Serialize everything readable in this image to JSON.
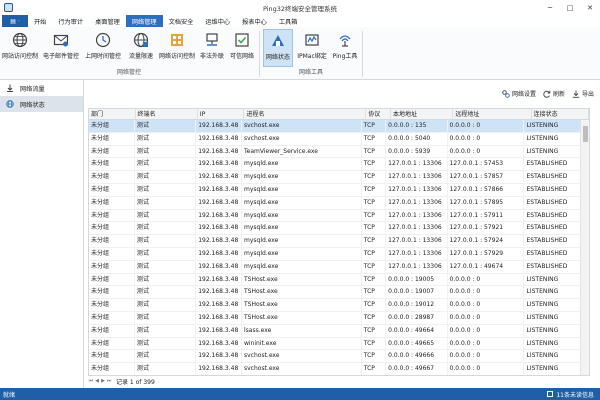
{
  "window": {
    "title": "Ping32终端安全管理系统",
    "minimize": "─",
    "maximize": "□",
    "close": "✕"
  },
  "menu": {
    "app_button": "▤ ·",
    "tabs": [
      "开始",
      "行为审计",
      "桌面管理",
      "网络管理",
      "文档安全",
      "运维中心",
      "报表中心",
      "工具箱"
    ],
    "active_tab": "网络管理"
  },
  "ribbon": {
    "group1": {
      "label": "网络管控",
      "buttons": [
        {
          "label": "网站访问控制",
          "icon": "globe-icon"
        },
        {
          "label": "电子邮件管控",
          "icon": "email-icon"
        },
        {
          "label": "上网时间管控",
          "icon": "clock-icon"
        },
        {
          "label": "流量限速",
          "icon": "speed-globe-icon"
        },
        {
          "label": "网络访问控制",
          "icon": "network-access-icon"
        },
        {
          "label": "非法外联",
          "icon": "external-connection-icon"
        },
        {
          "label": "可信网络",
          "icon": "trusted-network-icon"
        }
      ]
    },
    "group2": {
      "label": "网络工具",
      "buttons": [
        {
          "label": "网络状态",
          "icon": "network-status-icon"
        },
        {
          "label": "IPMac绑定",
          "icon": "ipmac-icon"
        },
        {
          "label": "Ping工具",
          "icon": "ping-icon"
        }
      ],
      "selected": "网络状态"
    }
  },
  "left_panel": {
    "items": [
      {
        "label": "网络流量",
        "icon": "download-arrow-icon"
      },
      {
        "label": "网络状态",
        "icon": "globe-icon"
      }
    ],
    "selected": "网络状态"
  },
  "toolbar": {
    "settings": "网络设置",
    "refresh": "刷新",
    "export": "导出"
  },
  "table": {
    "columns": [
      "部门",
      "终端名",
      "IP",
      "进程名",
      "协议",
      "本地地址",
      "远程地址",
      "连接状态"
    ],
    "rows": [
      [
        "未分组",
        "测试",
        "192.168.3.48",
        "svchost.exe",
        "TCP",
        "0.0.0.0 : 135",
        "0.0.0.0 : 0",
        "LISTENING"
      ],
      [
        "未分组",
        "测试",
        "192.168.3.48",
        "svchost.exe",
        "TCP",
        "0.0.0.0 : 5040",
        "0.0.0.0 : 0",
        "LISTENING"
      ],
      [
        "未分组",
        "测试",
        "192.168.3.48",
        "TeamViewer_Service.exe",
        "TCP",
        "0.0.0.0 : 5939",
        "0.0.0.0 : 0",
        "LISTENING"
      ],
      [
        "未分组",
        "测试",
        "192.168.3.48",
        "mysqld.exe",
        "TCP",
        "127.0.0.1 : 13306",
        "127.0.0.1 : 57453",
        "ESTABLISHED"
      ],
      [
        "未分组",
        "测试",
        "192.168.3.48",
        "mysqld.exe",
        "TCP",
        "127.0.0.1 : 13306",
        "127.0.0.1 : 57857",
        "ESTABLISHED"
      ],
      [
        "未分组",
        "测试",
        "192.168.3.48",
        "mysqld.exe",
        "TCP",
        "127.0.0.1 : 13306",
        "127.0.0.1 : 57866",
        "ESTABLISHED"
      ],
      [
        "未分组",
        "测试",
        "192.168.3.48",
        "mysqld.exe",
        "TCP",
        "127.0.0.1 : 13306",
        "127.0.0.1 : 57895",
        "ESTABLISHED"
      ],
      [
        "未分组",
        "测试",
        "192.168.3.48",
        "mysqld.exe",
        "TCP",
        "127.0.0.1 : 13306",
        "127.0.0.1 : 57911",
        "ESTABLISHED"
      ],
      [
        "未分组",
        "测试",
        "192.168.3.48",
        "mysqld.exe",
        "TCP",
        "127.0.0.1 : 13306",
        "127.0.0.1 : 57921",
        "ESTABLISHED"
      ],
      [
        "未分组",
        "测试",
        "192.168.3.48",
        "mysqld.exe",
        "TCP",
        "127.0.0.1 : 13306",
        "127.0.0.1 : 57924",
        "ESTABLISHED"
      ],
      [
        "未分组",
        "测试",
        "192.168.3.48",
        "mysqld.exe",
        "TCP",
        "127.0.0.1 : 13306",
        "127.0.0.1 : 57929",
        "ESTABLISHED"
      ],
      [
        "未分组",
        "测试",
        "192.168.3.48",
        "mysqld.exe",
        "TCP",
        "127.0.0.1 : 13306",
        "127.0.0.1 : 49674",
        "ESTABLISHED"
      ],
      [
        "未分组",
        "测试",
        "192.168.3.48",
        "TSHost.exe",
        "TCP",
        "0.0.0.0 : 19005",
        "0.0.0.0 : 0",
        "LISTENING"
      ],
      [
        "未分组",
        "测试",
        "192.168.3.48",
        "TSHost.exe",
        "TCP",
        "0.0.0.0 : 19007",
        "0.0.0.0 : 0",
        "LISTENING"
      ],
      [
        "未分组",
        "测试",
        "192.168.3.48",
        "TSHost.exe",
        "TCP",
        "0.0.0.0 : 19012",
        "0.0.0.0 : 0",
        "LISTENING"
      ],
      [
        "未分组",
        "测试",
        "192.168.3.48",
        "TSHost.exe",
        "TCP",
        "0.0.0.0 : 28987",
        "0.0.0.0 : 0",
        "LISTENING"
      ],
      [
        "未分组",
        "测试",
        "192.168.3.48",
        "lsass.exe",
        "TCP",
        "0.0.0.0 : 49664",
        "0.0.0.0 : 0",
        "LISTENING"
      ],
      [
        "未分组",
        "测试",
        "192.168.3.48",
        "wininit.exe",
        "TCP",
        "0.0.0.0 : 49665",
        "0.0.0.0 : 0",
        "LISTENING"
      ],
      [
        "未分组",
        "测试",
        "192.168.3.48",
        "svchost.exe",
        "TCP",
        "0.0.0.0 : 49666",
        "0.0.0.0 : 0",
        "LISTENING"
      ],
      [
        "未分组",
        "测试",
        "192.168.3.48",
        "svchost.exe",
        "TCP",
        "0.0.0.0 : 49667",
        "0.0.0.0 : 0",
        "LISTENING"
      ]
    ]
  },
  "pager": {
    "first": "⏮",
    "prev": "◀",
    "next": "▶",
    "last": "⏭",
    "text": "记录 1 of 399"
  },
  "status": {
    "left": "就绪",
    "right": "11条未读信息"
  }
}
